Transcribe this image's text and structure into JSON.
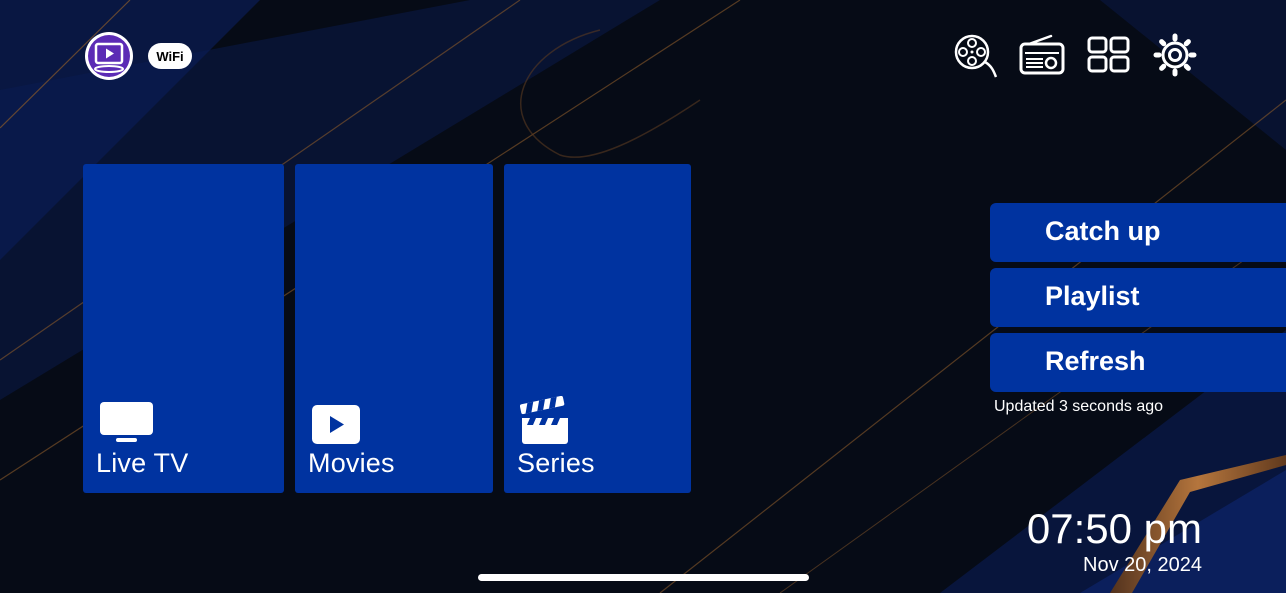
{
  "header": {
    "logo_icon": "tv-play-logo-icon",
    "wifi_label": "WiFi",
    "icons": [
      "film-reel-icon",
      "radio-icon",
      "grid-icon",
      "gear-icon"
    ]
  },
  "tiles": [
    {
      "label": "Live TV",
      "icon": "tv-icon"
    },
    {
      "label": "Movies",
      "icon": "play-icon"
    },
    {
      "label": "Series",
      "icon": "clapperboard-icon"
    }
  ],
  "side_menu": {
    "items": [
      "Catch up",
      "Playlist",
      "Refresh"
    ],
    "updated_text": "Updated 3 seconds ago"
  },
  "clock": {
    "time": "07:50 pm",
    "date": "Nov 20, 2024"
  },
  "colors": {
    "background": "#060b16",
    "tile": "#0033a0",
    "accent_line": "#b8732f"
  }
}
